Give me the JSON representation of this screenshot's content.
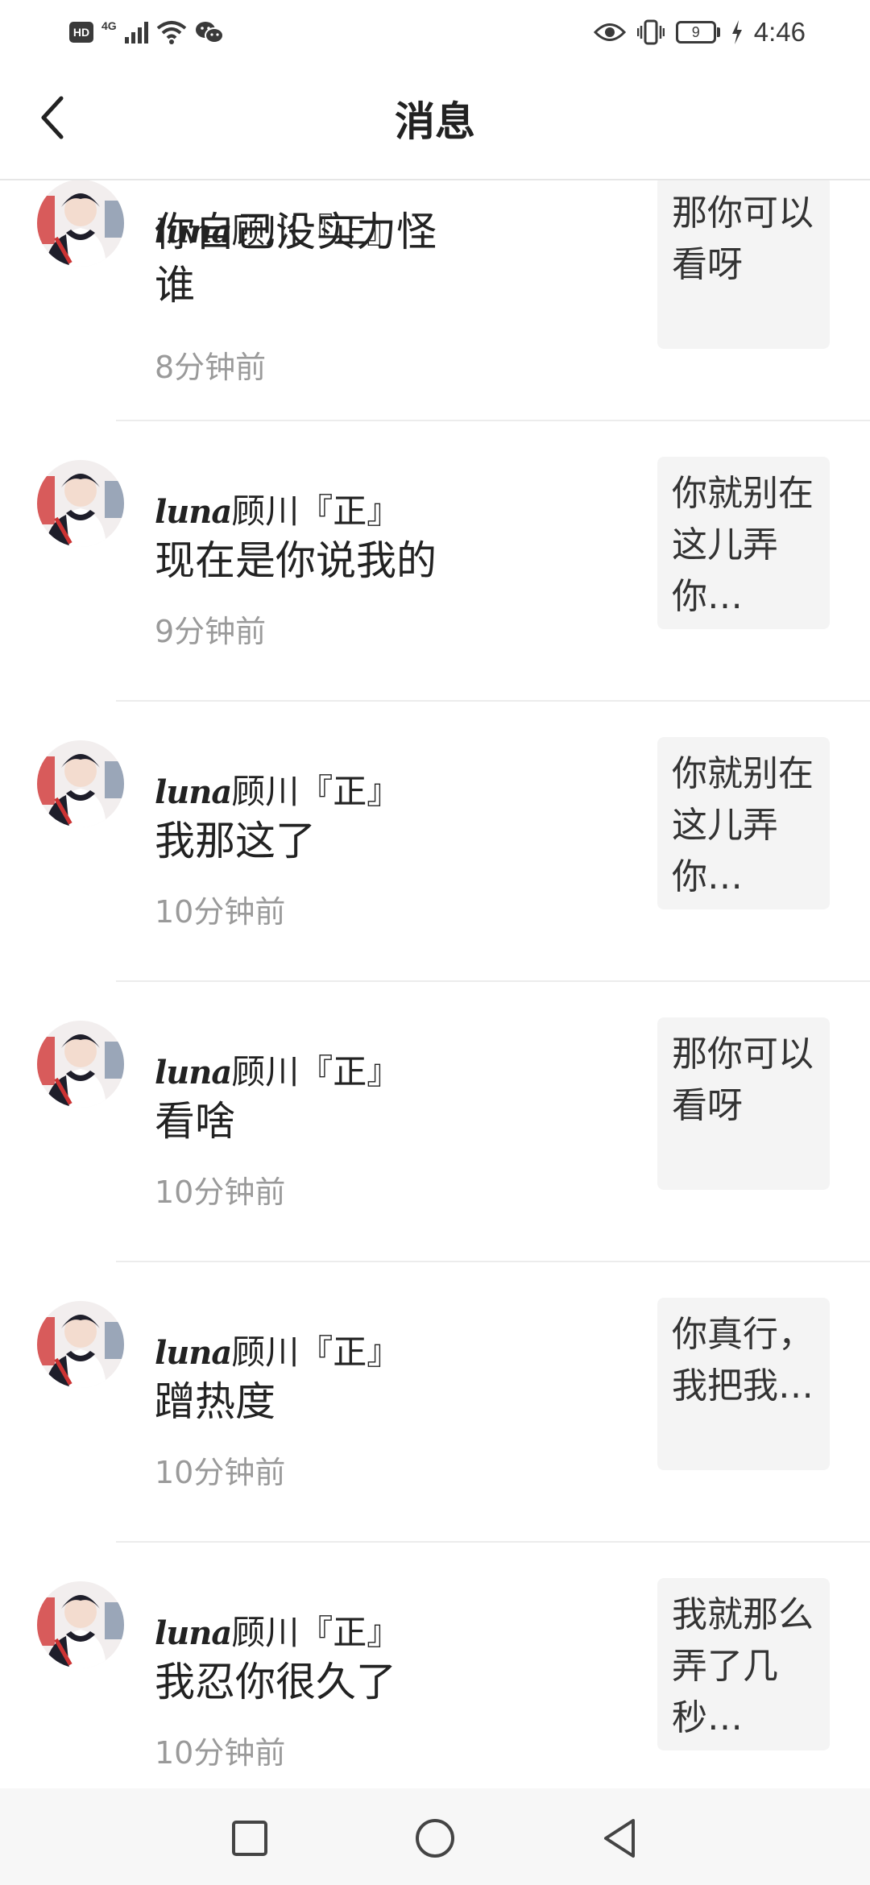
{
  "status_bar": {
    "left_icons": [
      "hd-icon",
      "4g-icon",
      "signal-icon",
      "wifi-icon",
      "wechat-icon"
    ],
    "hd_label": "HD",
    "network_label": "4G",
    "right_icons": [
      "eye-icon",
      "vibrate-icon",
      "battery-icon",
      "charging-icon"
    ],
    "battery": "9",
    "time": "4:46"
  },
  "header": {
    "title": "消息",
    "back_icon": "chevron-left-icon"
  },
  "messages": [
    {
      "name_script": "luna",
      "name_rest": "顾川『正』",
      "text": "你自己没实力怪谁",
      "time": "8分钟前",
      "quote": "那你可以看呀"
    },
    {
      "name_script": "luna",
      "name_rest": "顾川『正』",
      "text": "现在是你说我的",
      "time": "9分钟前",
      "quote": "你就别在这儿弄你…"
    },
    {
      "name_script": "luna",
      "name_rest": "顾川『正』",
      "text": "我那这了",
      "time": "10分钟前",
      "quote": "你就别在这儿弄你…"
    },
    {
      "name_script": "luna",
      "name_rest": "顾川『正』",
      "text": "看啥",
      "time": "10分钟前",
      "quote": "那你可以看呀"
    },
    {
      "name_script": "luna",
      "name_rest": "顾川『正』",
      "text": "蹭热度",
      "time": "10分钟前",
      "quote": "你真行，我把我…"
    },
    {
      "name_script": "luna",
      "name_rest": "顾川『正』",
      "text": "我忍你很久了",
      "time": "10分钟前",
      "quote": "我就那么弄了几秒…"
    }
  ],
  "nav_bar": {
    "buttons": [
      "recents-square-icon",
      "home-circle-icon",
      "back-triangle-icon"
    ]
  },
  "colors": {
    "background": "#ffffff",
    "text_primary": "#222222",
    "text_secondary": "#9a9a9a",
    "quote_bg": "#f4f4f4",
    "divider": "#ececec"
  }
}
